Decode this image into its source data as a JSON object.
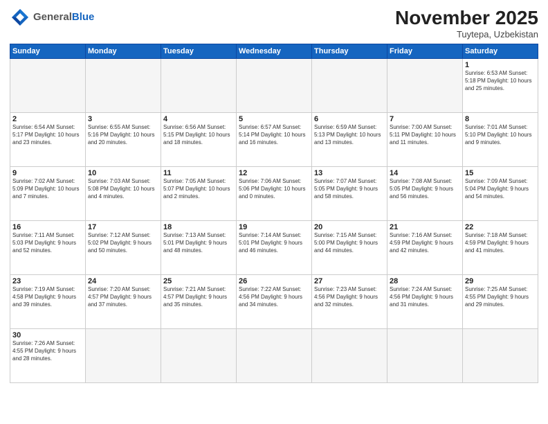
{
  "header": {
    "logo_general": "General",
    "logo_blue": "Blue",
    "month_title": "November 2025",
    "location": "Tuytepa, Uzbekistan"
  },
  "weekdays": [
    "Sunday",
    "Monday",
    "Tuesday",
    "Wednesday",
    "Thursday",
    "Friday",
    "Saturday"
  ],
  "weeks": [
    [
      {
        "day": "",
        "info": ""
      },
      {
        "day": "",
        "info": ""
      },
      {
        "day": "",
        "info": ""
      },
      {
        "day": "",
        "info": ""
      },
      {
        "day": "",
        "info": ""
      },
      {
        "day": "",
        "info": ""
      },
      {
        "day": "1",
        "info": "Sunrise: 6:53 AM\nSunset: 5:18 PM\nDaylight: 10 hours\nand 25 minutes."
      }
    ],
    [
      {
        "day": "2",
        "info": "Sunrise: 6:54 AM\nSunset: 5:17 PM\nDaylight: 10 hours\nand 23 minutes."
      },
      {
        "day": "3",
        "info": "Sunrise: 6:55 AM\nSunset: 5:16 PM\nDaylight: 10 hours\nand 20 minutes."
      },
      {
        "day": "4",
        "info": "Sunrise: 6:56 AM\nSunset: 5:15 PM\nDaylight: 10 hours\nand 18 minutes."
      },
      {
        "day": "5",
        "info": "Sunrise: 6:57 AM\nSunset: 5:14 PM\nDaylight: 10 hours\nand 16 minutes."
      },
      {
        "day": "6",
        "info": "Sunrise: 6:59 AM\nSunset: 5:13 PM\nDaylight: 10 hours\nand 13 minutes."
      },
      {
        "day": "7",
        "info": "Sunrise: 7:00 AM\nSunset: 5:11 PM\nDaylight: 10 hours\nand 11 minutes."
      },
      {
        "day": "8",
        "info": "Sunrise: 7:01 AM\nSunset: 5:10 PM\nDaylight: 10 hours\nand 9 minutes."
      }
    ],
    [
      {
        "day": "9",
        "info": "Sunrise: 7:02 AM\nSunset: 5:09 PM\nDaylight: 10 hours\nand 7 minutes."
      },
      {
        "day": "10",
        "info": "Sunrise: 7:03 AM\nSunset: 5:08 PM\nDaylight: 10 hours\nand 4 minutes."
      },
      {
        "day": "11",
        "info": "Sunrise: 7:05 AM\nSunset: 5:07 PM\nDaylight: 10 hours\nand 2 minutes."
      },
      {
        "day": "12",
        "info": "Sunrise: 7:06 AM\nSunset: 5:06 PM\nDaylight: 10 hours\nand 0 minutes."
      },
      {
        "day": "13",
        "info": "Sunrise: 7:07 AM\nSunset: 5:05 PM\nDaylight: 9 hours\nand 58 minutes."
      },
      {
        "day": "14",
        "info": "Sunrise: 7:08 AM\nSunset: 5:05 PM\nDaylight: 9 hours\nand 56 minutes."
      },
      {
        "day": "15",
        "info": "Sunrise: 7:09 AM\nSunset: 5:04 PM\nDaylight: 9 hours\nand 54 minutes."
      }
    ],
    [
      {
        "day": "16",
        "info": "Sunrise: 7:11 AM\nSunset: 5:03 PM\nDaylight: 9 hours\nand 52 minutes."
      },
      {
        "day": "17",
        "info": "Sunrise: 7:12 AM\nSunset: 5:02 PM\nDaylight: 9 hours\nand 50 minutes."
      },
      {
        "day": "18",
        "info": "Sunrise: 7:13 AM\nSunset: 5:01 PM\nDaylight: 9 hours\nand 48 minutes."
      },
      {
        "day": "19",
        "info": "Sunrise: 7:14 AM\nSunset: 5:01 PM\nDaylight: 9 hours\nand 46 minutes."
      },
      {
        "day": "20",
        "info": "Sunrise: 7:15 AM\nSunset: 5:00 PM\nDaylight: 9 hours\nand 44 minutes."
      },
      {
        "day": "21",
        "info": "Sunrise: 7:16 AM\nSunset: 4:59 PM\nDaylight: 9 hours\nand 42 minutes."
      },
      {
        "day": "22",
        "info": "Sunrise: 7:18 AM\nSunset: 4:59 PM\nDaylight: 9 hours\nand 41 minutes."
      }
    ],
    [
      {
        "day": "23",
        "info": "Sunrise: 7:19 AM\nSunset: 4:58 PM\nDaylight: 9 hours\nand 39 minutes."
      },
      {
        "day": "24",
        "info": "Sunrise: 7:20 AM\nSunset: 4:57 PM\nDaylight: 9 hours\nand 37 minutes."
      },
      {
        "day": "25",
        "info": "Sunrise: 7:21 AM\nSunset: 4:57 PM\nDaylight: 9 hours\nand 35 minutes."
      },
      {
        "day": "26",
        "info": "Sunrise: 7:22 AM\nSunset: 4:56 PM\nDaylight: 9 hours\nand 34 minutes."
      },
      {
        "day": "27",
        "info": "Sunrise: 7:23 AM\nSunset: 4:56 PM\nDaylight: 9 hours\nand 32 minutes."
      },
      {
        "day": "28",
        "info": "Sunrise: 7:24 AM\nSunset: 4:56 PM\nDaylight: 9 hours\nand 31 minutes."
      },
      {
        "day": "29",
        "info": "Sunrise: 7:25 AM\nSunset: 4:55 PM\nDaylight: 9 hours\nand 29 minutes."
      }
    ],
    [
      {
        "day": "30",
        "info": "Sunrise: 7:26 AM\nSunset: 4:55 PM\nDaylight: 9 hours\nand 28 minutes."
      },
      {
        "day": "",
        "info": ""
      },
      {
        "day": "",
        "info": ""
      },
      {
        "day": "",
        "info": ""
      },
      {
        "day": "",
        "info": ""
      },
      {
        "day": "",
        "info": ""
      },
      {
        "day": "",
        "info": ""
      }
    ]
  ]
}
